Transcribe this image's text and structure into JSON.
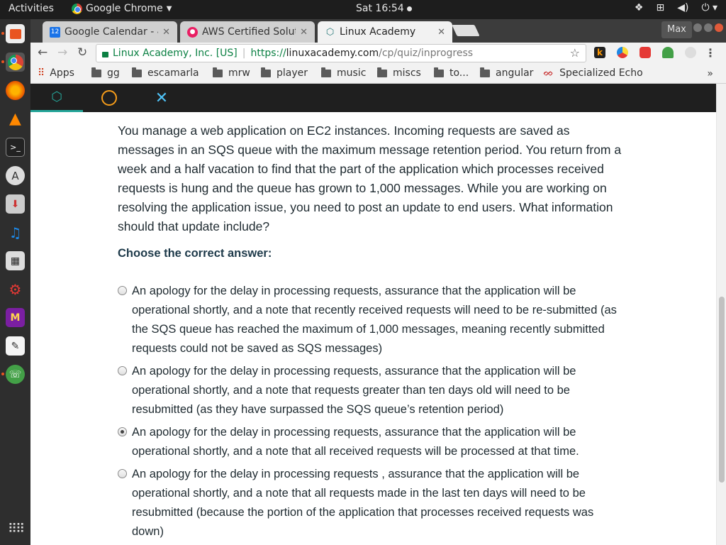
{
  "system": {
    "activities": "Activities",
    "app_name": "Google Chrome",
    "clock": "Sat 16:54"
  },
  "tabs": [
    {
      "title": "Google Calendar - 4",
      "icon": "calendar-icon",
      "badge": "12"
    },
    {
      "title": "AWS Certified Solut",
      "icon": "acloud-icon"
    },
    {
      "title": "Linux Academy",
      "icon": "linux-academy-icon"
    }
  ],
  "window": {
    "max_label": "Max"
  },
  "address": {
    "secure_label": "Linux Academy, Inc. [US]",
    "scheme": "https://",
    "host": "linuxacademy.com",
    "path": "/cp/quiz/inprogress"
  },
  "bookmarks": [
    {
      "label": "Apps"
    },
    {
      "label": "gg"
    },
    {
      "label": "escamarla"
    },
    {
      "label": "mrw"
    },
    {
      "label": "player"
    },
    {
      "label": "music"
    },
    {
      "label": "miscs"
    },
    {
      "label": "to..."
    },
    {
      "label": "angular"
    },
    {
      "label": "Specialized Echo"
    }
  ],
  "quiz": {
    "question": "You manage a web application on EC2 instances. Incoming requests are saved as messages in an SQS queue with the maximum message retention period. You return from a week and a half vacation to find that the part of the application which processes received requests is hung and the queue has grown to 1,000 messages. While you are working on resolving the application issue, you need to post an update to end users. What information should that update include?",
    "prompt": "Choose the correct answer:",
    "options": [
      {
        "text": "An apology for the delay in processing requests, assurance that the application will be operational shortly, and a note that recently received requests will need to be re-submitted (as the SQS queue has reached the maximum of 1,000 messages, meaning recently submitted requests could not be saved as SQS messages)",
        "selected": false
      },
      {
        "text": "An apology for the delay in processing requests, assurance that the application will be operational shortly, and a note that requests greater than ten days old will need to be resubmitted (as they have surpassed the SQS queue’s retention period)",
        "selected": false
      },
      {
        "text": "An apology for the delay in processing requests, assurance that the application will be operational shortly, and a note that all received requests will be processed at that time.",
        "selected": true
      },
      {
        "text": "An apology for the delay in processing requests , assurance that the application will be operational shortly, and a note that all requests made in the last ten days will need to be resubmitted (because the portion of the application that processes received requests was down)",
        "selected": false
      }
    ]
  }
}
